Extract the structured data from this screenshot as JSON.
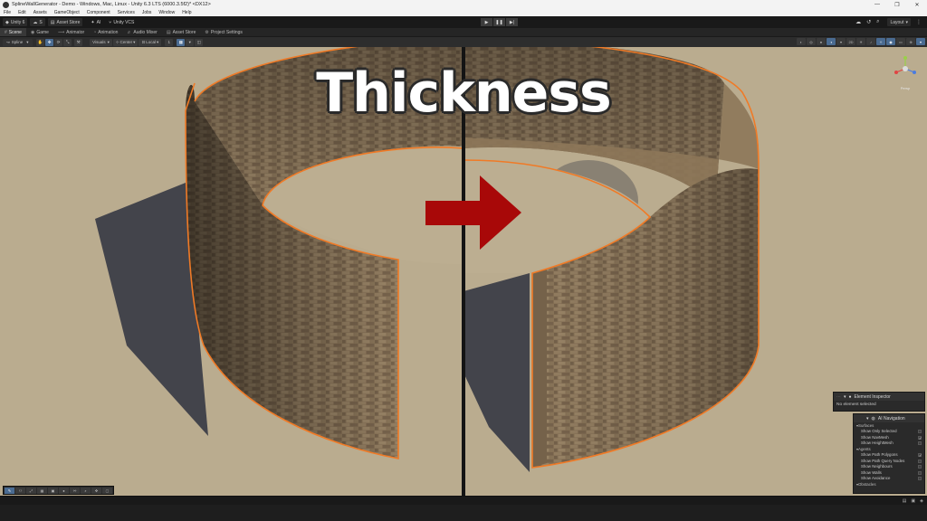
{
  "window": {
    "title": "SplineWallGenerator - Demo - Windows, Mac, Linux - Unity 6.3 LTS (6000.3.5f2)* <DX12>",
    "controls": [
      "—",
      "❐",
      "✕"
    ]
  },
  "menu": [
    "File",
    "Edit",
    "Assets",
    "GameObject",
    "Component",
    "Services",
    "Jobs",
    "Window",
    "Help"
  ],
  "main_toolbar": {
    "account": "Unity 6",
    "cloud": "S",
    "asset_store": "Asset Store",
    "ai": "AI",
    "vcs": "Unity VCS",
    "play": "▶",
    "pause": "❚❚",
    "step": "▶|",
    "layout": "Layout"
  },
  "tabs": [
    {
      "label": "Scene",
      "icon": "#",
      "active": true
    },
    {
      "label": "Game",
      "icon": "◉",
      "active": false
    },
    {
      "label": "Animator",
      "icon": "⟿",
      "active": false
    },
    {
      "label": "Animation",
      "icon": "◔",
      "active": false
    },
    {
      "label": "Audio Mixer",
      "icon": "♬",
      "active": false
    },
    {
      "label": "Asset Store",
      "icon": "▤",
      "active": false
    },
    {
      "label": "Project Settings",
      "icon": "⚙",
      "active": false
    }
  ],
  "scene_toolbar": {
    "spline": "Spline",
    "visuals": "Visuals",
    "center": "Center",
    "local": "Local",
    "snap_value": "1"
  },
  "overlay_text": "Thickness",
  "gizmo": {
    "label": "Persp"
  },
  "element_inspector": {
    "title": "Element Inspector",
    "message": "No element selected"
  },
  "ai_navigation": {
    "title": "AI Navigation",
    "groups": [
      {
        "label": "Surfaces",
        "items": [
          {
            "label": "Show Only Selected",
            "checked": false
          },
          {
            "label": "Show NavMesh",
            "checked": true
          },
          {
            "label": "Show HeightMesh",
            "checked": false
          }
        ]
      },
      {
        "label": "Agents",
        "items": [
          {
            "label": "Show Path Polygons",
            "checked": true
          },
          {
            "label": "Show Path Query Nodes",
            "checked": false
          },
          {
            "label": "Show Neighbours",
            "checked": false
          },
          {
            "label": "Show Walls",
            "checked": false
          },
          {
            "label": "Show Avoidance",
            "checked": false
          }
        ]
      },
      {
        "label": "Obstacles",
        "items": []
      }
    ]
  },
  "colors": {
    "ground": "#b9ab8e",
    "brick": "#8a7358",
    "selection_outline": "#f07a26",
    "arrow": "#a80808",
    "accent": "#4a6b91"
  },
  "icons": {
    "play": "play-icon",
    "pause": "pause-icon",
    "step": "step-icon",
    "arrow": "right-arrow"
  }
}
